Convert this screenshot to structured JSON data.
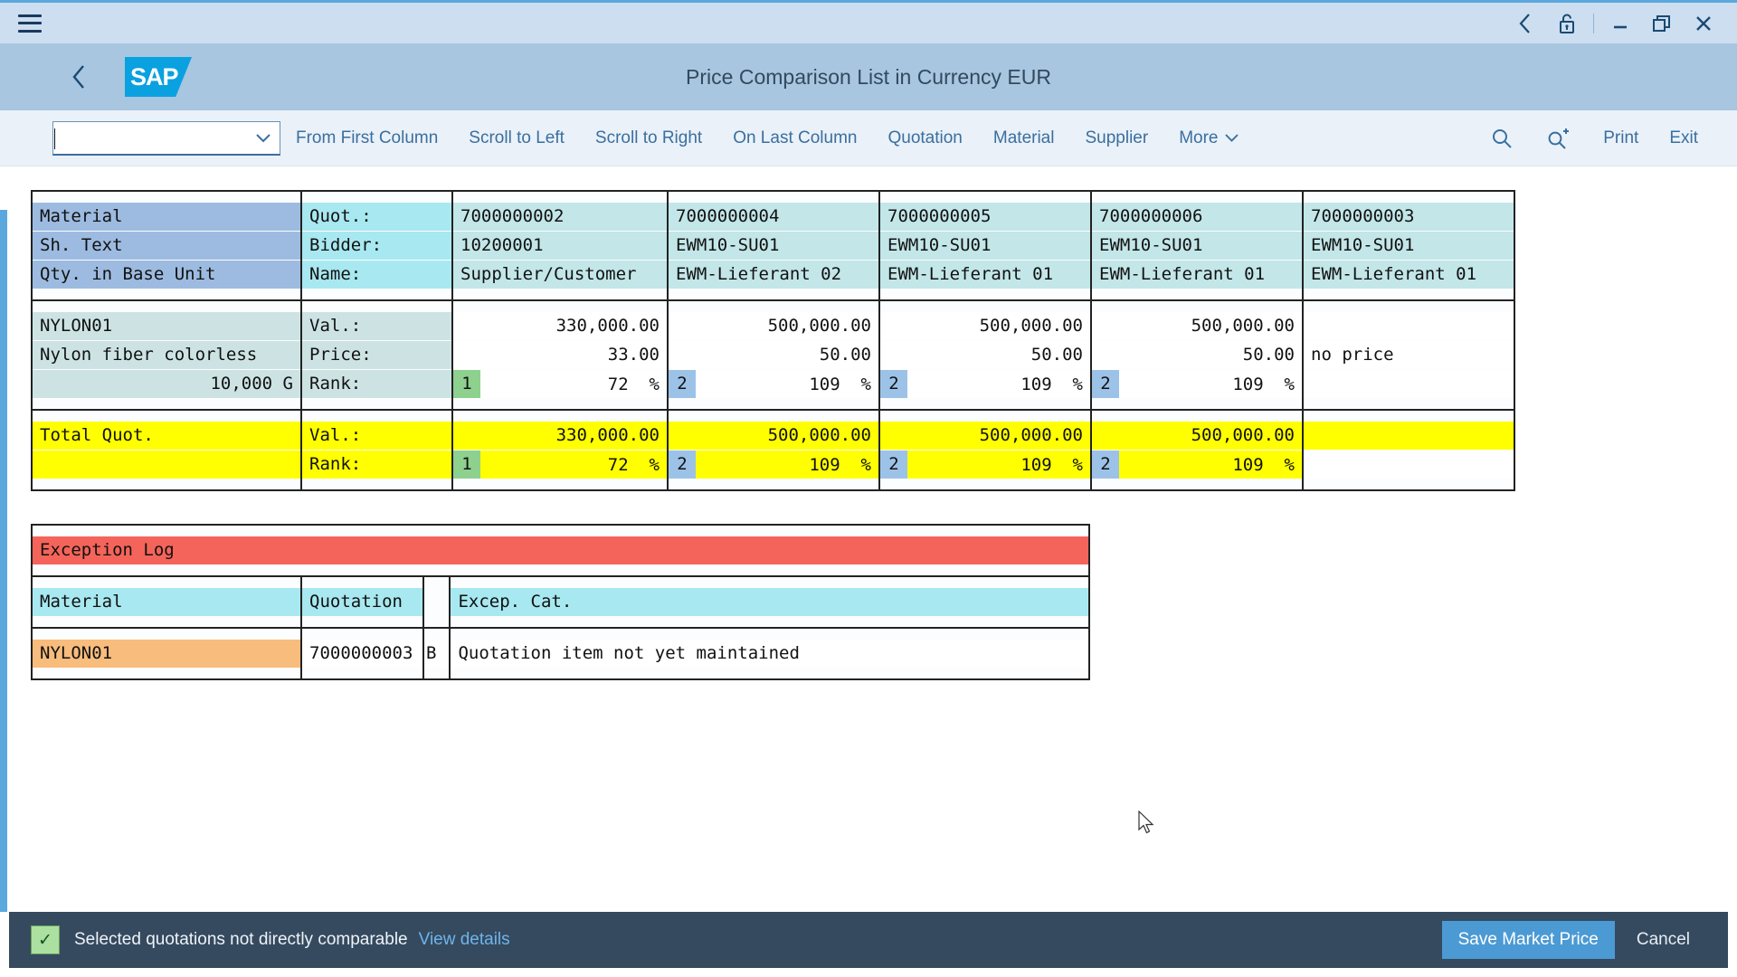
{
  "window": {
    "menu_icon": "hamburger-icon",
    "back_icon": "back-chevron-icon",
    "lock_icon": "unlock-icon",
    "minimize_icon": "minimize-icon",
    "restore_icon": "restore-icon",
    "close_icon": "close-icon"
  },
  "shell": {
    "back_label": "Back",
    "logo_text": "SAP",
    "title": "Price Comparison List in Currency EUR"
  },
  "toolbar": {
    "combo_value": "",
    "combo_placeholder": "",
    "buttons": [
      {
        "label": "From First Column"
      },
      {
        "label": "Scroll to Left"
      },
      {
        "label": "Scroll to Right"
      },
      {
        "label": "On Last Column"
      },
      {
        "label": "Quotation"
      },
      {
        "label": "Material"
      },
      {
        "label": "Supplier"
      },
      {
        "label": "More"
      }
    ],
    "search_icon": "search-icon",
    "search_plus_icon": "search-plus-icon",
    "print_label": "Print",
    "exit_label": "Exit"
  },
  "comparison": {
    "row_labels": {
      "material": "Material",
      "short_text": "Sh. Text",
      "qty": "Qty. in Base Unit"
    },
    "quote_labels": {
      "quot": "Quot.:",
      "bidder": "Bidder:",
      "name": "Name:"
    },
    "item_value_labels": {
      "val": "Val.:",
      "price": "Price:",
      "rank": "Rank:"
    },
    "total_label": "Total Quot.",
    "total_value_labels": {
      "val": "Val.:",
      "rank": "Rank:"
    },
    "header_columns": [
      {
        "quot": "7000000002",
        "bidder": "10200001",
        "name": "Supplier/Customer"
      },
      {
        "quot": "7000000004",
        "bidder": "EWM10-SU01",
        "name": "EWM-Lieferant 02"
      },
      {
        "quot": "7000000005",
        "bidder": "EWM10-SU01",
        "name": "EWM-Lieferant 01"
      },
      {
        "quot": "7000000006",
        "bidder": "EWM10-SU01",
        "name": "EWM-Lieferant 01"
      },
      {
        "quot": "7000000003",
        "bidder": "EWM10-SU01",
        "name": "EWM-Lieferant 01"
      }
    ],
    "item": {
      "material": "NYLON01",
      "short_text": "Nylon fiber colorless",
      "quantity": "10,000  G"
    },
    "item_columns": [
      {
        "value": "330,000.00",
        "price": "33.00",
        "rank": "1",
        "rank_color": "green",
        "percent": "72  %",
        "no_price": false
      },
      {
        "value": "500,000.00",
        "price": "50.00",
        "rank": "2",
        "rank_color": "blue",
        "percent": "109  %",
        "no_price": false
      },
      {
        "value": "500,000.00",
        "price": "50.00",
        "rank": "2",
        "rank_color": "blue",
        "percent": "109  %",
        "no_price": false
      },
      {
        "value": "500,000.00",
        "price": "50.00",
        "rank": "2",
        "rank_color": "blue",
        "percent": "109  %",
        "no_price": false
      },
      {
        "value": "",
        "price": "no price",
        "rank": "",
        "rank_color": "none",
        "percent": "",
        "no_price": true
      }
    ],
    "total_columns": [
      {
        "value": "330,000.00",
        "rank": "1",
        "rank_color": "green",
        "percent": "72  %",
        "empty": false
      },
      {
        "value": "500,000.00",
        "rank": "2",
        "rank_color": "blue",
        "percent": "109  %",
        "empty": false
      },
      {
        "value": "500,000.00",
        "rank": "2",
        "rank_color": "blue",
        "percent": "109  %",
        "empty": false
      },
      {
        "value": "500,000.00",
        "rank": "2",
        "rank_color": "blue",
        "percent": "109  %",
        "empty": false
      },
      {
        "value": "",
        "rank": "",
        "rank_color": "none",
        "percent": "",
        "empty": true
      }
    ]
  },
  "exception_log": {
    "title": "Exception Log",
    "headers": {
      "material": "Material",
      "quotation": "Quotation",
      "category": "Excep. Cat."
    },
    "rows": [
      {
        "material": "NYLON01",
        "quotation": "7000000003",
        "code": "B",
        "text": "Quotation item not yet maintained"
      }
    ]
  },
  "footer": {
    "status_icon": "checkbox-checked-icon",
    "message": "Selected quotations not directly comparable",
    "link": "View details",
    "save_label": "Save Market Price",
    "cancel_label": "Cancel"
  },
  "colors": {
    "accent": "#4b9ad4",
    "shell": "#a8c6e0",
    "rank_best": "#8ed08e",
    "rank_other": "#9dc2e8",
    "exception": "#f4645a",
    "total_row": "#ffff00",
    "footer_bg": "#354a5f"
  }
}
